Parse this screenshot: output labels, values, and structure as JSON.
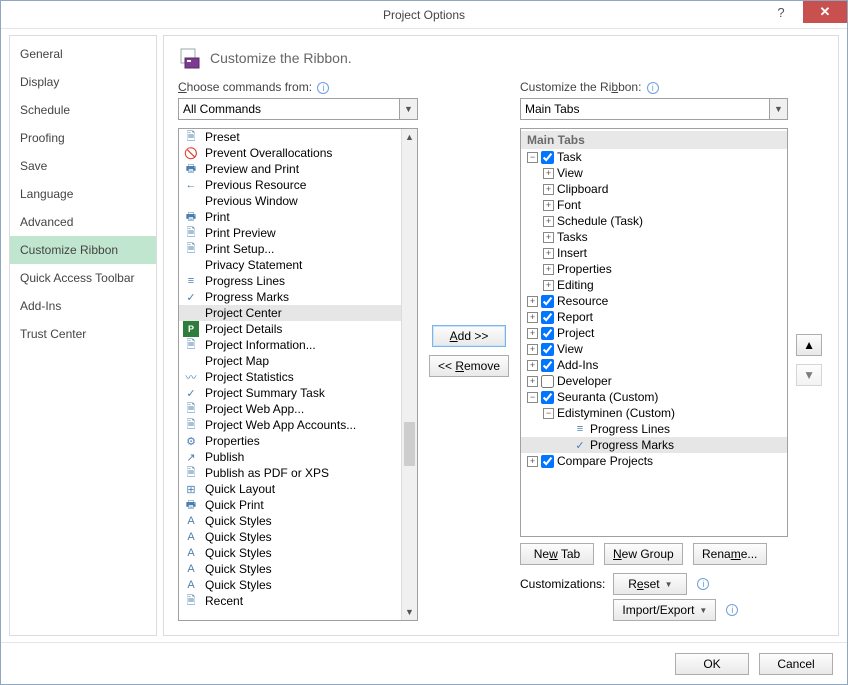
{
  "window": {
    "title": "Project Options"
  },
  "sidebar": {
    "items": [
      {
        "label": "General"
      },
      {
        "label": "Display"
      },
      {
        "label": "Schedule"
      },
      {
        "label": "Proofing"
      },
      {
        "label": "Save"
      },
      {
        "label": "Language"
      },
      {
        "label": "Advanced"
      },
      {
        "label": "Customize Ribbon",
        "selected": true
      },
      {
        "label": "Quick Access Toolbar"
      },
      {
        "label": "Add-Ins"
      },
      {
        "label": "Trust Center"
      }
    ]
  },
  "header": {
    "text": "Customize the Ribbon."
  },
  "left": {
    "label_pre": "",
    "label_u": "C",
    "label_post": "hoose commands from:",
    "combo": "All Commands",
    "commands": [
      {
        "icon": "🗎",
        "text": "Preset",
        "sub": "▶"
      },
      {
        "icon": "🚫",
        "text": "Prevent Overallocations"
      },
      {
        "icon": "🖶",
        "text": "Preview and Print",
        "sub": "▶",
        "subcolor": "#3b78c4"
      },
      {
        "icon": "←",
        "text": "Previous Resource"
      },
      {
        "icon": "",
        "text": "Previous Window"
      },
      {
        "icon": "🖶",
        "text": "Print"
      },
      {
        "icon": "🗎",
        "text": "Print Preview"
      },
      {
        "icon": "🗎",
        "text": "Print Setup..."
      },
      {
        "icon": "",
        "text": "Privacy Statement"
      },
      {
        "icon": "≡",
        "text": "Progress Lines"
      },
      {
        "icon": "✓",
        "text": "Progress Marks"
      },
      {
        "icon": "",
        "text": "Project Center",
        "selected": true
      },
      {
        "icon": "P",
        "text": "Project Details",
        "iconbg": "#2f7d3b"
      },
      {
        "icon": "🗎",
        "text": "Project Information..."
      },
      {
        "icon": "",
        "text": "Project Map"
      },
      {
        "icon": "〰",
        "text": "Project Statistics"
      },
      {
        "icon": "✓",
        "text": "Project Summary Task"
      },
      {
        "icon": "🗎",
        "text": "Project Web App..."
      },
      {
        "icon": "🗎",
        "text": "Project Web App Accounts..."
      },
      {
        "icon": "⚙",
        "text": "Properties"
      },
      {
        "icon": "↗",
        "text": "Publish"
      },
      {
        "icon": "🗎",
        "text": "Publish as PDF or XPS"
      },
      {
        "icon": "⊞",
        "text": "Quick Layout",
        "sub": "▶"
      },
      {
        "icon": "🖶",
        "text": "Quick Print"
      },
      {
        "icon": "A",
        "text": "Quick Styles",
        "sub": "▶"
      },
      {
        "icon": "A",
        "text": "Quick Styles",
        "sub": "▶"
      },
      {
        "icon": "A",
        "text": "Quick Styles",
        "sub": "▶"
      },
      {
        "icon": "A",
        "text": "Quick Styles",
        "sub": "▶"
      },
      {
        "icon": "A",
        "text": "Quick Styles",
        "sub": "▶"
      },
      {
        "icon": "🗎",
        "text": "Recent",
        "sub": "▶"
      }
    ]
  },
  "mid": {
    "add": "Add >>",
    "remove": "<< Remove"
  },
  "right": {
    "label_pre": "Customize the Ri",
    "label_u": "b",
    "label_post": "bon:",
    "combo": "Main Tabs",
    "tree_header": "Main Tabs",
    "buttons": {
      "newtab": "New Tab",
      "newgroup": "New Group",
      "rename": "Rename..."
    },
    "cust_label": "Customizations:",
    "reset": "Reset",
    "importexport": "Import/Export",
    "tabs": [
      {
        "exp": "-",
        "chk": true,
        "label": "Task",
        "children": [
          {
            "exp": "+",
            "label": "View"
          },
          {
            "exp": "+",
            "label": "Clipboard"
          },
          {
            "exp": "+",
            "label": "Font"
          },
          {
            "exp": "+",
            "label": "Schedule (Task)"
          },
          {
            "exp": "+",
            "label": "Tasks"
          },
          {
            "exp": "+",
            "label": "Insert"
          },
          {
            "exp": "+",
            "label": "Properties"
          },
          {
            "exp": "+",
            "label": "Editing"
          }
        ]
      },
      {
        "exp": "+",
        "chk": true,
        "label": "Resource"
      },
      {
        "exp": "+",
        "chk": true,
        "label": "Report"
      },
      {
        "exp": "+",
        "chk": true,
        "label": "Project"
      },
      {
        "exp": "+",
        "chk": true,
        "label": "View"
      },
      {
        "exp": "+",
        "chk": true,
        "label": "Add-Ins"
      },
      {
        "exp": "+",
        "chk": false,
        "label": "Developer"
      },
      {
        "exp": "-",
        "chk": true,
        "label": "Seuranta (Custom)",
        "children": [
          {
            "exp": "-",
            "label": "Edistyminen (Custom)",
            "children": [
              {
                "icon": "≡",
                "label": "Progress Lines"
              },
              {
                "icon": "✓",
                "label": "Progress Marks",
                "selected": true
              }
            ]
          }
        ]
      },
      {
        "exp": "+",
        "chk": true,
        "label": "Compare Projects"
      }
    ]
  },
  "footer": {
    "ok": "OK",
    "cancel": "Cancel"
  }
}
